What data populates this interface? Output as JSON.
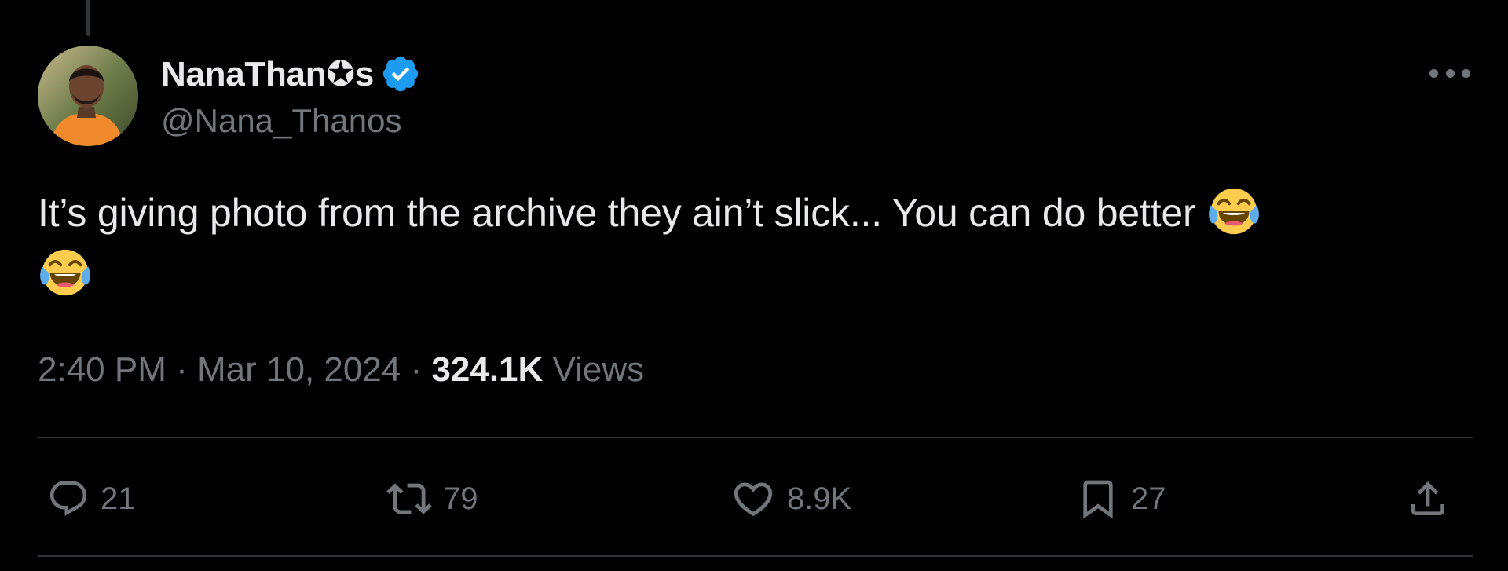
{
  "author": {
    "display_name": "NanaThan✪s",
    "handle": "@Nana_Thanos",
    "verified": true,
    "verified_color": "#1d9bf0",
    "avatar": "avatar-photo"
  },
  "tweet": {
    "text": "It’s giving photo from the archive they ain’t slick... You can do better",
    "emojis": [
      "face-with-tears-of-joy",
      "face-with-tears-of-joy"
    ]
  },
  "meta": {
    "time": "2:40 PM",
    "separator": "·",
    "date": "Mar 10, 2024",
    "views_count": "324.1K",
    "views_label": "Views"
  },
  "actions": {
    "reply_count": "21",
    "repost_count": "79",
    "like_count": "8.9K",
    "bookmark_count": "27"
  },
  "icons": {
    "more": "more-horizontal-icon",
    "reply": "reply-icon",
    "repost": "repost-icon",
    "like": "heart-icon",
    "bookmark": "bookmark-icon",
    "share": "share-icon"
  },
  "colors": {
    "background": "#000000",
    "primary_text": "#e7e9ea",
    "secondary_text": "#71767b",
    "divider": "#2f3336"
  }
}
